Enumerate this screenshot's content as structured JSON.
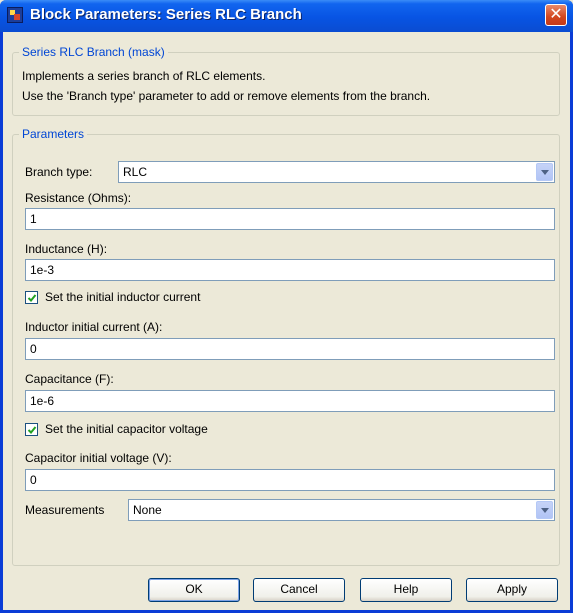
{
  "window": {
    "title": "Block Parameters: Series RLC Branch"
  },
  "mask_group": {
    "legend": "Series RLC Branch (mask)",
    "description": [
      "Implements a series branch of RLC elements.",
      "Use the 'Branch type' parameter to add or remove elements from the branch."
    ]
  },
  "params": {
    "legend": "Parameters",
    "branch_type": {
      "label": "Branch type:",
      "value": "RLC"
    },
    "resistance": {
      "label": "Resistance (Ohms):",
      "value": "1"
    },
    "inductance": {
      "label": "Inductance (H):",
      "value": "1e-3"
    },
    "set_inductor_current": {
      "label": "Set the initial inductor current",
      "checked": true
    },
    "inductor_current": {
      "label": "Inductor initial current (A):",
      "value": "0"
    },
    "capacitance": {
      "label": "Capacitance (F):",
      "value": "1e-6"
    },
    "set_capacitor_voltage": {
      "label": "Set the initial capacitor voltage",
      "checked": true
    },
    "capacitor_voltage": {
      "label": "Capacitor initial voltage (V):",
      "value": "0"
    },
    "measurements": {
      "label": "Measurements",
      "value": "None"
    }
  },
  "buttons": {
    "ok": "OK",
    "cancel": "Cancel",
    "help": "Help",
    "apply": "Apply"
  },
  "colors": {
    "titlebar": "#0854e3",
    "legend_text": "#0046d5",
    "dialog_bg": "#ece9d8",
    "check_mark": "#21a121"
  }
}
